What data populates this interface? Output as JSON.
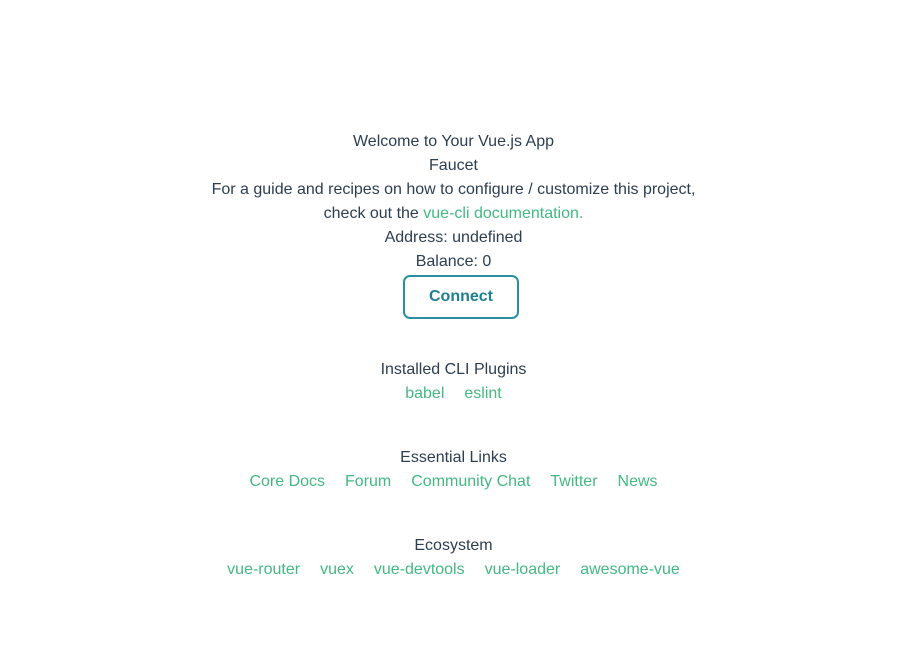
{
  "header": {
    "welcome": "Welcome to Your Vue.js App",
    "subtitle": "Faucet",
    "guide_text": "For a guide and recipes on how to configure / customize this project,",
    "check_out_prefix": "check out the ",
    "docs_link": "vue-cli documentation."
  },
  "wallet": {
    "address_label": "Address: undefined",
    "balance_label": "Balance: 0",
    "connect_button": "Connect"
  },
  "plugins": {
    "title": "Installed CLI Plugins",
    "items": [
      "babel",
      "eslint"
    ]
  },
  "essential_links": {
    "title": "Essential Links",
    "items": [
      "Core Docs",
      "Forum",
      "Community Chat",
      "Twitter",
      "News"
    ]
  },
  "ecosystem": {
    "title": "Ecosystem",
    "items": [
      "vue-router",
      "vuex",
      "vue-devtools",
      "vue-loader",
      "awesome-vue"
    ]
  },
  "colors": {
    "text": "#2c3e50",
    "link": "#42b983",
    "button_border": "#2a8fa0"
  }
}
